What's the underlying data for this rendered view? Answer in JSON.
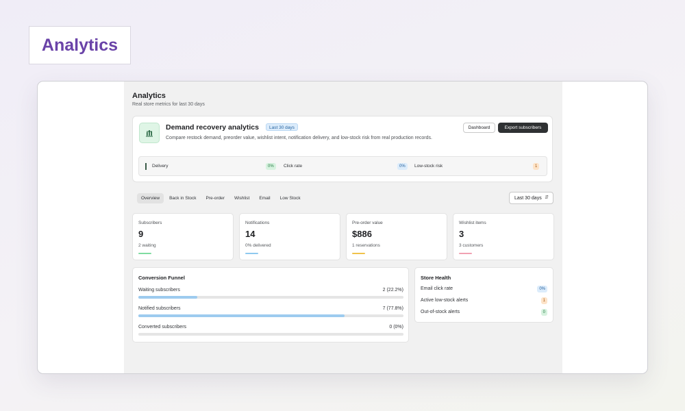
{
  "hero": {
    "label": "Analytics"
  },
  "page": {
    "title": "Analytics",
    "subtitle": "Real store metrics for last 30 days"
  },
  "banner": {
    "title": "Demand recovery analytics",
    "badge": "Last 30 days",
    "description": "Compare restock demand, preorder value, wishlist intent, notification delivery, and low-stock risk from real production records.",
    "icon": "bar-chart-icon",
    "dashboard_label": "Dashboard",
    "export_label": "Export subscribers",
    "metrics": [
      {
        "label": "Delivery",
        "value": "0%",
        "tone": "green"
      },
      {
        "label": "Click rate",
        "value": "0%",
        "tone": "blue"
      },
      {
        "label": "Low-stock risk",
        "value": "1",
        "tone": "orange"
      }
    ]
  },
  "tabs": [
    {
      "label": "Overview",
      "active": true
    },
    {
      "label": "Back in Stock",
      "active": false
    },
    {
      "label": "Pre-order",
      "active": false
    },
    {
      "label": "Wishlist",
      "active": false
    },
    {
      "label": "Email",
      "active": false
    },
    {
      "label": "Low Stock",
      "active": false
    }
  ],
  "range_select": {
    "value": "Last 30 days"
  },
  "stats": [
    {
      "label": "Subscribers",
      "value": "9",
      "sub": "2 waiting",
      "color": "#7fdca0"
    },
    {
      "label": "Notifications",
      "value": "14",
      "sub": "0% delivered",
      "color": "#8ec9ef"
    },
    {
      "label": "Pre-order value",
      "value": "$886",
      "sub": "1 reservations",
      "color": "#f0c24a"
    },
    {
      "label": "Wishlist items",
      "value": "3",
      "sub": "3 customers",
      "color": "#f1a1b2"
    }
  ],
  "funnel": {
    "title": "Conversion Funnel",
    "rows": [
      {
        "label": "Waiting subscribers",
        "value": "2 (22.2%)",
        "fraction": 0.222
      },
      {
        "label": "Notified subscribers",
        "value": "7 (77.8%)",
        "fraction": 0.778
      },
      {
        "label": "Converted subscribers",
        "value": "0 (0%)",
        "fraction": 0
      }
    ]
  },
  "health": {
    "title": "Store Health",
    "rows": [
      {
        "label": "Email click rate",
        "value": "0%",
        "tone": "blue"
      },
      {
        "label": "Active low-stock alerts",
        "value": "1",
        "tone": "orange"
      },
      {
        "label": "Out-of-stock alerts",
        "value": "0",
        "tone": "green"
      }
    ]
  }
}
